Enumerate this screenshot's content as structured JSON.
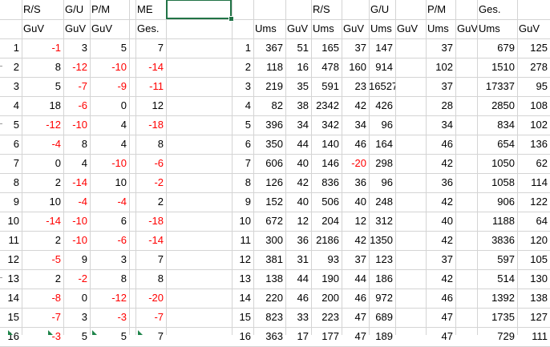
{
  "header": {
    "row1": {
      "B": "R/S",
      "C": "G/U",
      "D": "P/M",
      "F": "ME",
      "L": "R/S",
      "N": "G/U",
      "P": "P/M",
      "R": "Ges."
    },
    "row2": {
      "B": "GuV",
      "C": "GuV",
      "D": "GuV",
      "F": "Ges.",
      "J": "Ums",
      "K": "GuV",
      "L": "Ums",
      "M": "GuV",
      "N": "Ums",
      "O": "GuV",
      "P": "Ums",
      "Q": "GuV",
      "R": "Ums",
      "S": "GuV"
    }
  },
  "rows": [
    [
      "1",
      "-1",
      "3",
      "5",
      "7",
      "1",
      "367",
      "51",
      "165",
      "37",
      "147",
      "37",
      "679",
      "125"
    ],
    [
      "2",
      "8",
      "-12",
      "-10",
      "-14",
      "2",
      "118",
      "16",
      "478",
      "160",
      "914",
      "102",
      "1510",
      "278"
    ],
    [
      "3",
      "5",
      "-7",
      "-9",
      "-11",
      "3",
      "219",
      "35",
      "591",
      "23",
      "16527",
      "37",
      "17337",
      "95"
    ],
    [
      "4",
      "18",
      "-6",
      "0",
      "12",
      "4",
      "82",
      "38",
      "2342",
      "42",
      "426",
      "28",
      "2850",
      "108"
    ],
    [
      "5",
      "-12",
      "-10",
      "4",
      "-18",
      "5",
      "396",
      "34",
      "342",
      "34",
      "96",
      "34",
      "834",
      "102"
    ],
    [
      "6",
      "-4",
      "8",
      "4",
      "8",
      "6",
      "350",
      "44",
      "140",
      "46",
      "164",
      "46",
      "654",
      "136"
    ],
    [
      "7",
      "0",
      "4",
      "-10",
      "-6",
      "7",
      "606",
      "40",
      "146",
      "-20",
      "298",
      "42",
      "1050",
      "62"
    ],
    [
      "8",
      "2",
      "-14",
      "10",
      "-2",
      "8",
      "126",
      "42",
      "836",
      "36",
      "96",
      "36",
      "1058",
      "114"
    ],
    [
      "9",
      "10",
      "-4",
      "-4",
      "2",
      "9",
      "152",
      "40",
      "506",
      "40",
      "248",
      "42",
      "906",
      "122"
    ],
    [
      "10",
      "-14",
      "-10",
      "6",
      "-18",
      "10",
      "672",
      "12",
      "204",
      "12",
      "312",
      "40",
      "1188",
      "64"
    ],
    [
      "11",
      "2",
      "-10",
      "-6",
      "-14",
      "11",
      "300",
      "36",
      "2186",
      "42",
      "1350",
      "42",
      "3836",
      "120"
    ],
    [
      "12",
      "-5",
      "9",
      "3",
      "7",
      "12",
      "381",
      "31",
      "93",
      "37",
      "123",
      "37",
      "597",
      "105"
    ],
    [
      "13",
      "2",
      "-2",
      "8",
      "8",
      "13",
      "138",
      "44",
      "190",
      "44",
      "186",
      "42",
      "514",
      "130"
    ],
    [
      "14",
      "-8",
      "0",
      "-12",
      "-20",
      "14",
      "220",
      "46",
      "200",
      "46",
      "972",
      "46",
      "1392",
      "138"
    ],
    [
      "15",
      "-7",
      "3",
      "-3",
      "-7",
      "15",
      "823",
      "33",
      "223",
      "47",
      "689",
      "47",
      "1735",
      "127"
    ],
    [
      "16",
      "-3",
      "5",
      "5",
      "7",
      "16",
      "363",
      "17",
      "177",
      "47",
      "189",
      "47",
      "729",
      "111"
    ]
  ],
  "colors": {
    "negative": "#ff0000",
    "selection": "#217346",
    "grid": "#d4d4d4"
  }
}
